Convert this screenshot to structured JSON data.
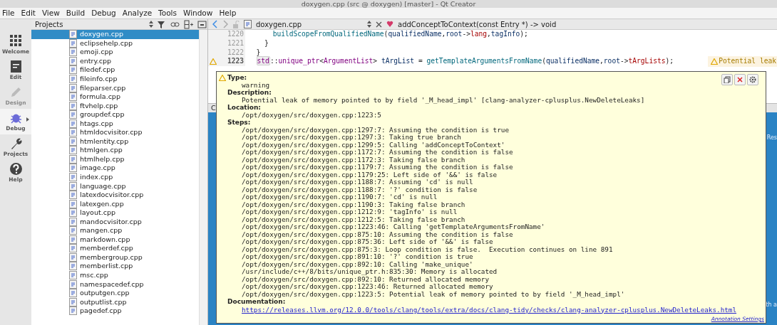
{
  "window": {
    "title": "doxygen.cpp (src @ doxygen) [master] - Qt Creator"
  },
  "menu": [
    "File",
    "Edit",
    "View",
    "Build",
    "Debug",
    "Analyze",
    "Tools",
    "Window",
    "Help"
  ],
  "modes": [
    {
      "label": "Welcome",
      "kind": "grid",
      "selected": false,
      "disabled": false
    },
    {
      "label": "Edit",
      "kind": "doc",
      "selected": false,
      "disabled": false
    },
    {
      "label": "Design",
      "kind": "pen",
      "selected": false,
      "disabled": true
    },
    {
      "label": "Debug",
      "kind": "bug",
      "selected": true,
      "disabled": false
    },
    {
      "label": "Projects",
      "kind": "wrench",
      "selected": false,
      "disabled": false
    },
    {
      "label": "Help",
      "kind": "help",
      "selected": false,
      "disabled": false
    }
  ],
  "projects": {
    "title": "Projects",
    "files": [
      {
        "name": "doxygen.cpp",
        "selected": true
      },
      {
        "name": "eclipsehelp.cpp",
        "selected": false
      },
      {
        "name": "emoji.cpp",
        "selected": false
      },
      {
        "name": "entry.cpp",
        "selected": false
      },
      {
        "name": "filedef.cpp",
        "selected": false
      },
      {
        "name": "fileinfo.cpp",
        "selected": false
      },
      {
        "name": "fileparser.cpp",
        "selected": false
      },
      {
        "name": "formula.cpp",
        "selected": false
      },
      {
        "name": "ftvhelp.cpp",
        "selected": false
      },
      {
        "name": "groupdef.cpp",
        "selected": false
      },
      {
        "name": "htags.cpp",
        "selected": false
      },
      {
        "name": "htmldocvisitor.cpp",
        "selected": false
      },
      {
        "name": "htmlentity.cpp",
        "selected": false
      },
      {
        "name": "htmlgen.cpp",
        "selected": false
      },
      {
        "name": "htmlhelp.cpp",
        "selected": false
      },
      {
        "name": "image.cpp",
        "selected": false
      },
      {
        "name": "index.cpp",
        "selected": false
      },
      {
        "name": "language.cpp",
        "selected": false
      },
      {
        "name": "latexdocvisitor.cpp",
        "selected": false
      },
      {
        "name": "latexgen.cpp",
        "selected": false
      },
      {
        "name": "layout.cpp",
        "selected": false
      },
      {
        "name": "mandocvisitor.cpp",
        "selected": false
      },
      {
        "name": "mangen.cpp",
        "selected": false
      },
      {
        "name": "markdown.cpp",
        "selected": false
      },
      {
        "name": "memberdef.cpp",
        "selected": false
      },
      {
        "name": "membergroup.cpp",
        "selected": false
      },
      {
        "name": "memberlist.cpp",
        "selected": false
      },
      {
        "name": "msc.cpp",
        "selected": false
      },
      {
        "name": "namespacedef.cpp",
        "selected": false
      },
      {
        "name": "outputgen.cpp",
        "selected": false
      },
      {
        "name": "outputlist.cpp",
        "selected": false
      },
      {
        "name": "pagedef.cpp",
        "selected": false
      }
    ]
  },
  "editor": {
    "file": "doxygen.cpp",
    "symbol": "addConceptToContext(const Entry *) -> void",
    "lines": [
      {
        "number": "1220",
        "current": false,
        "warning": false,
        "tokens": [
          {
            "kind": "fn",
            "text": "      buildScopeFromQualifiedName"
          },
          {
            "kind": "plain",
            "text": "("
          },
          {
            "kind": "var",
            "text": "qualifiedName"
          },
          {
            "kind": "plain",
            "text": ","
          },
          {
            "kind": "var",
            "text": "root"
          },
          {
            "kind": "plain",
            "text": "->"
          },
          {
            "kind": "member",
            "text": "lang"
          },
          {
            "kind": "plain",
            "text": ","
          },
          {
            "kind": "var",
            "text": "tagInfo"
          },
          {
            "kind": "plain",
            "text": ");"
          }
        ]
      },
      {
        "number": "1221",
        "current": false,
        "warning": false,
        "tokens": [
          {
            "kind": "plain",
            "text": "    }"
          }
        ]
      },
      {
        "number": "1222",
        "current": false,
        "warning": false,
        "tokens": [
          {
            "kind": "plain",
            "text": "  }"
          }
        ]
      },
      {
        "number": "1223",
        "current": true,
        "warning": true,
        "tokens": [
          {
            "kind": "ns",
            "text": "  std"
          },
          {
            "kind": "plain",
            "text": "::"
          },
          {
            "kind": "type",
            "text": "unique_ptr"
          },
          {
            "kind": "plain",
            "text": "<"
          },
          {
            "kind": "type",
            "text": "ArgumentList"
          },
          {
            "kind": "plain",
            "text": "> "
          },
          {
            "kind": "var",
            "text": "tArgList"
          },
          {
            "kind": "plain",
            "text": " = "
          },
          {
            "kind": "fn",
            "text": "getTemplateArgumentsFromName"
          },
          {
            "kind": "plain",
            "text": "("
          },
          {
            "kind": "var",
            "text": "qualifiedName"
          },
          {
            "kind": "plain",
            "text": ","
          },
          {
            "kind": "var",
            "text": "root"
          },
          {
            "kind": "plain",
            "text": "->"
          },
          {
            "kind": "member",
            "text": "tArgLists"
          },
          {
            "kind": "plain",
            "text": ");"
          }
        ],
        "annotation": "Potential leak"
      }
    ]
  },
  "bottom_pane": {
    "header": "C",
    "texts": [
      "Res",
      "th a"
    ]
  },
  "tooltip": {
    "type_label": "Type:",
    "type": "warning",
    "description_label": "Description:",
    "description": "Potential leak of memory pointed to by field '_M_head_impl' [clang-analyzer-cplusplus.NewDeleteLeaks]",
    "location_label": "Location:",
    "location": "/opt/doxygen/src/doxygen.cpp:1223:5",
    "steps_label": "Steps:",
    "steps": [
      "/opt/doxygen/src/doxygen.cpp:1297:7: Assuming the condition is true",
      "/opt/doxygen/src/doxygen.cpp:1297:3: Taking true branch",
      "/opt/doxygen/src/doxygen.cpp:1299:5: Calling 'addConceptToContext'",
      "/opt/doxygen/src/doxygen.cpp:1172:7: Assuming the condition is false",
      "/opt/doxygen/src/doxygen.cpp:1172:3: Taking false branch",
      "/opt/doxygen/src/doxygen.cpp:1179:7: Assuming the condition is false",
      "/opt/doxygen/src/doxygen.cpp:1179:25: Left side of '&&' is false",
      "/opt/doxygen/src/doxygen.cpp:1188:7: Assuming 'cd' is null",
      "/opt/doxygen/src/doxygen.cpp:1188:7: '?' condition is false",
      "/opt/doxygen/src/doxygen.cpp:1190:7: 'cd' is null",
      "/opt/doxygen/src/doxygen.cpp:1190:3: Taking false branch",
      "/opt/doxygen/src/doxygen.cpp:1212:9: 'tagInfo' is null",
      "/opt/doxygen/src/doxygen.cpp:1212:5: Taking false branch",
      "/opt/doxygen/src/doxygen.cpp:1223:46: Calling 'getTemplateArgumentsFromName'",
      "/opt/doxygen/src/doxygen.cpp:875:10: Assuming the condition is false",
      "/opt/doxygen/src/doxygen.cpp:875:36: Left side of '&&' is false",
      "/opt/doxygen/src/doxygen.cpp:875:3: Loop condition is false.  Execution continues on line 891",
      "/opt/doxygen/src/doxygen.cpp:891:10: '?' condition is true",
      "/opt/doxygen/src/doxygen.cpp:892:10: Calling 'make_unique'",
      "/usr/include/c++/8/bits/unique_ptr.h:835:30: Memory is allocated",
      "/opt/doxygen/src/doxygen.cpp:892:10: Returned allocated memory",
      "/opt/doxygen/src/doxygen.cpp:1223:46: Returned allocated memory",
      "/opt/doxygen/src/doxygen.cpp:1223:5: Potential leak of memory pointed to by field '_M_head_impl'"
    ],
    "documentation_label": "Documentation:",
    "documentation": "https://releases.llvm.org/12.0.0/tools/clang/tools/extra/docs/clang-tidy/checks/clang-analyzer-cplusplus.NewDeleteLeaks.html",
    "settings_link": "Annotation Settings"
  }
}
